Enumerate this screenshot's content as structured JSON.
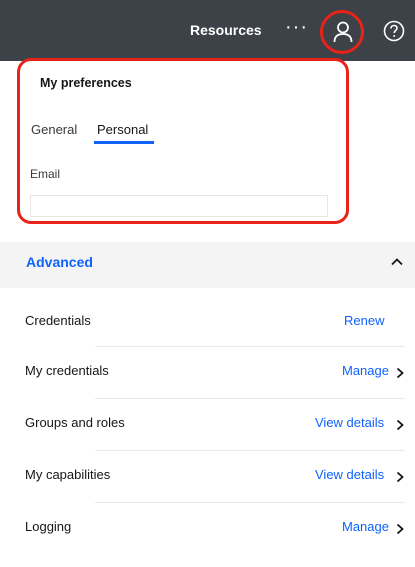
{
  "header": {
    "resources_label": "Resources",
    "more_label": "···",
    "user_icon": "user-icon",
    "help_icon": "help-icon",
    "highlight_color": "#e8231a",
    "background_color": "#3d4148"
  },
  "preferences": {
    "title": "My preferences",
    "tabs": [
      {
        "label": "General",
        "selected": false
      },
      {
        "label": "Personal",
        "selected": true
      }
    ],
    "email_label": "Email",
    "email_value": "",
    "accent_color": "#0f62fe"
  },
  "advanced": {
    "title": "Advanced",
    "expanded": true,
    "rows": [
      {
        "label": "Credentials",
        "action": "Renew",
        "has_chevron": false
      },
      {
        "label": "My credentials",
        "action": "Manage",
        "has_chevron": true
      },
      {
        "label": "Groups and roles",
        "action": "View details",
        "has_chevron": true
      },
      {
        "label": "My capabilities",
        "action": "View details",
        "has_chevron": true
      },
      {
        "label": "Logging",
        "action": "Manage",
        "has_chevron": true
      }
    ]
  }
}
